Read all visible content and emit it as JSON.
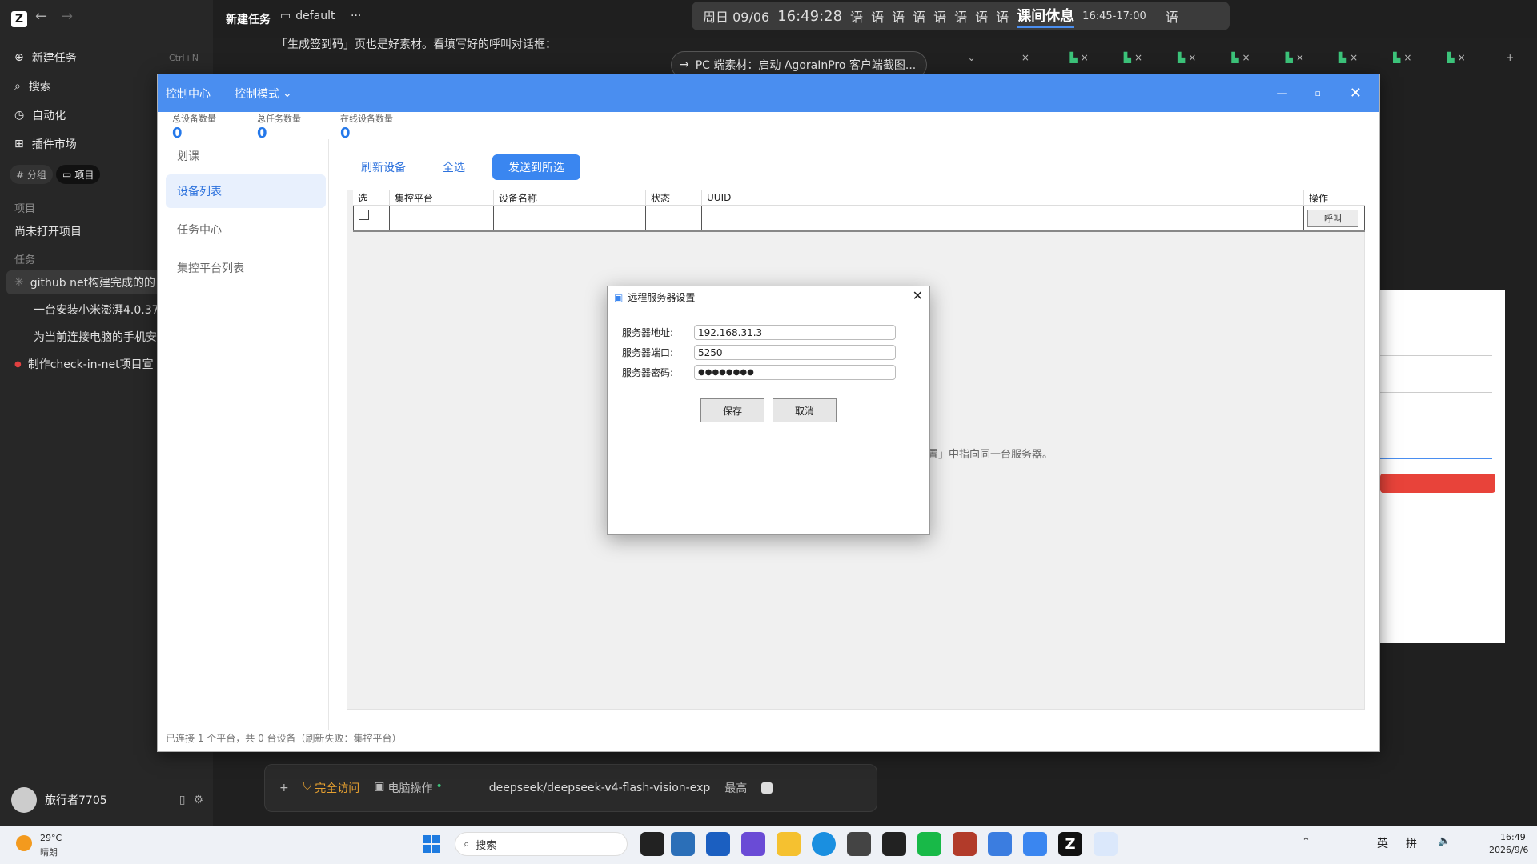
{
  "sidebar": {
    "logo": "Z",
    "new_task": "新建任务",
    "new_task_shortcut": "Ctrl+N",
    "search": "搜索",
    "automation": "自动化",
    "plugins": "插件市场",
    "tab_group": "# 分组",
    "tab_project": "项目",
    "section_projects": "项目",
    "no_project": "尚未打开项目",
    "section_tasks": "任务",
    "tasks": [
      "github net构建完成的的",
      "一台安装小米澎湃4.0.37",
      "为当前连接电脑的手机安",
      "制作check-in-net项目宣"
    ]
  },
  "topbar": {
    "task_title": "新建任务",
    "folder": "default",
    "more": "···",
    "date": "周日 09/06",
    "time": "16:49:28",
    "lang_items": [
      "语",
      "语",
      "语",
      "语",
      "语",
      "语",
      "语",
      "语"
    ],
    "break_label": "课间休息",
    "break_range": "16:45-17:00",
    "lang_last": "语"
  },
  "chat": {
    "line1": "「生成签到码」页也是好素材。看填写好的呼叫对话框：",
    "pc_button": "PC 端素材：启动 AgoraInPro 客户端截图..."
  },
  "window": {
    "title": "控制中心",
    "mode": "控制模式",
    "stats": [
      {
        "label": "总设备数量",
        "value": "0"
      },
      {
        "label": "总任务数量",
        "value": "0"
      },
      {
        "label": "在线设备数量",
        "value": "0"
      }
    ],
    "menu": [
      "划课",
      "设备列表",
      "任务中心",
      "集控平台列表"
    ],
    "buttons": {
      "refresh": "刷新设备",
      "select_all": "全选",
      "send": "发送到所选"
    },
    "columns": [
      "选",
      "集控平台",
      "设备名称",
      "状态",
      "UUID",
      "操作"
    ],
    "call_btn": "呼叫",
    "hint": "置」中指向同一台服务器。",
    "status": "已连接 1 个平台，共 0 台设备（刷新失败：集控平台）"
  },
  "dialog": {
    "title": "远程服务器设置",
    "addr_label": "服务器地址:",
    "addr": "192.168.31.3",
    "port_label": "服务器端口:",
    "port": "5250",
    "pwd_label": "服务器密码:",
    "pwd": "●●●●●●●●",
    "save": "保存",
    "cancel": "取消"
  },
  "composer": {
    "plus": "+",
    "access": "完全访问",
    "pc_op": "电脑操作",
    "model": "deepseek/deepseek-v4-flash-vision-exp",
    "level": "最高"
  },
  "user": {
    "name": "旅行者7705"
  },
  "taskbar": {
    "temp": "29°C",
    "weather": "晴朗",
    "search": "搜索",
    "ime1": "英",
    "ime2": "拼",
    "time": "16:49",
    "date": "2026/9/6"
  },
  "colors": {
    "accent": "#4a8ef0",
    "primary_btn": "#3a86f0",
    "stat_value": "#2478ea"
  }
}
